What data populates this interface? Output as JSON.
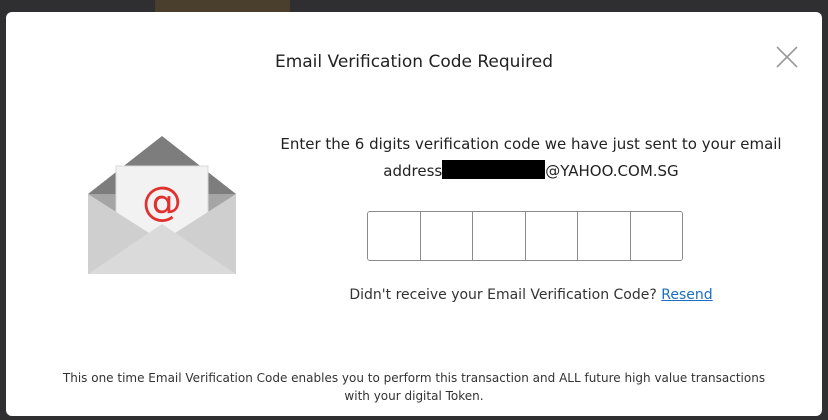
{
  "dialog": {
    "title": "Email Verification Code Required",
    "prompt_line1": "Enter the 6 digits verification code we have just sent to your email",
    "address_label": "address",
    "email_suffix": "@YAHOO.COM.SG",
    "code_length": 6,
    "code_values": [
      "",
      "",
      "",
      "",
      "",
      ""
    ],
    "resend_question": "Didn't receive your Email Verification Code?",
    "resend_link": "Resend",
    "footer_line1": "This one time Email Verification Code enables you to perform this transaction and ALL future high value transactions",
    "footer_line2": "with your digital Token."
  },
  "icons": {
    "close": "close-icon",
    "envelope": "envelope-email-icon"
  },
  "colors": {
    "link": "#1a6fc4",
    "at_symbol": "#e0312f",
    "envelope": "#c9c9c9"
  }
}
